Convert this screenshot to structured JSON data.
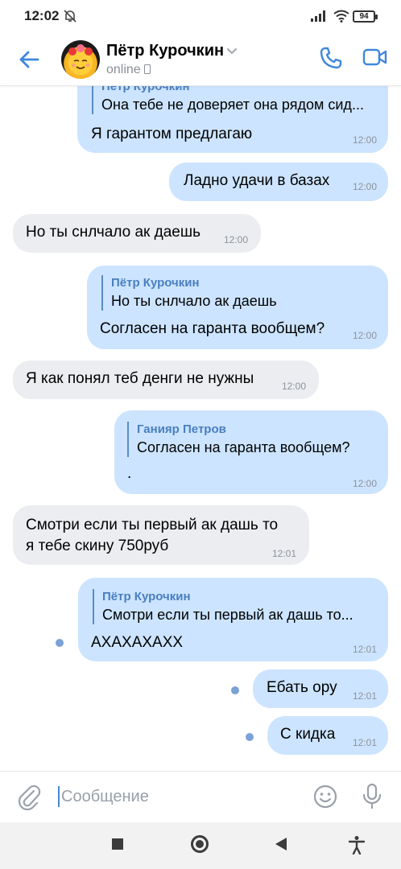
{
  "status_bar": {
    "time": "12:02",
    "battery": "94"
  },
  "header": {
    "contact_name": "Пётр Курочкин",
    "contact_status": "online"
  },
  "messages": [
    {
      "direction": "out",
      "reply_to": {
        "author": "Пётр Курочкин",
        "text": "Она тебе не доверяет она рядом сид..."
      },
      "text": "Я гарантом предлагаю",
      "time": "12:00"
    },
    {
      "direction": "out",
      "text": "Ладно удачи в базах",
      "time": "12:00"
    },
    {
      "direction": "in",
      "text": "Но ты снлчало ак даешь",
      "time": "12:00"
    },
    {
      "direction": "out",
      "reply_to": {
        "author": "Пётр Курочкин",
        "text": "Но ты снлчало ак даешь"
      },
      "text": "Согласен на гаранта вообщем?",
      "time": "12:00"
    },
    {
      "direction": "in",
      "text": "Я как понял теб денги не нужны",
      "time": "12:00"
    },
    {
      "direction": "out",
      "reply_to": {
        "author": "Ганияр Петров",
        "text": "Согласен на гаранта вообщем?"
      },
      "text": ".",
      "time": "12:00"
    },
    {
      "direction": "in",
      "text_lines": [
        "Смотри если ты первый ак дашь то",
        "я тебе скину 750руб"
      ],
      "time": "12:01"
    },
    {
      "direction": "out",
      "unread": true,
      "reply_to": {
        "author": "Пётр Курочкин",
        "text": "Смотри если ты первый ак дашь то..."
      },
      "text": "АХАХАХАХХ",
      "time": "12:01"
    },
    {
      "direction": "out",
      "unread": true,
      "text": "Ебать ору",
      "time": "12:01"
    },
    {
      "direction": "out",
      "unread": true,
      "text": "С кидка",
      "time": "12:01"
    }
  ],
  "composer": {
    "placeholder": "Сообщение"
  },
  "icons": {
    "back": "arrow-left-icon",
    "phone": "phone-icon",
    "video": "video-camera-icon",
    "attach": "paperclip-icon",
    "emoji": "smiley-icon",
    "mic": "microphone-icon"
  },
  "colors": {
    "accent": "#4a86d6",
    "outgoing_bubble": "#cce4ff",
    "incoming_bubble": "#ebedf0"
  }
}
